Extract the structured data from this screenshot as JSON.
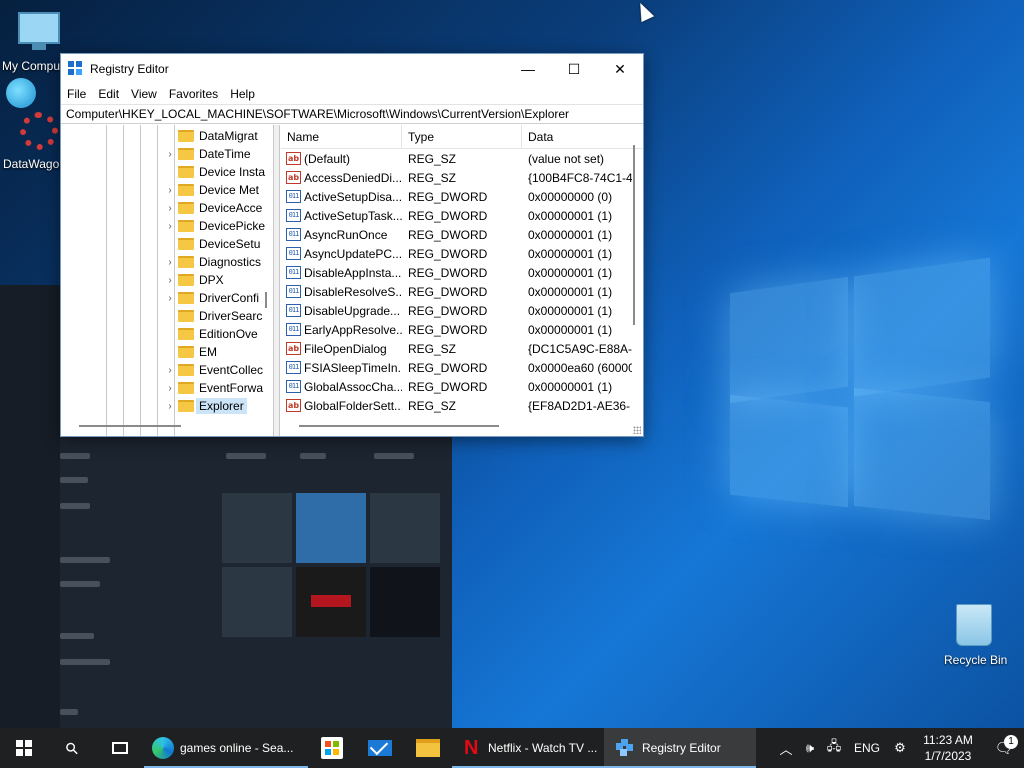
{
  "desktop": {
    "icons": {
      "my_computer": "My Computer",
      "datawagon": "DataWagon",
      "recycle_bin": "Recycle Bin"
    }
  },
  "window": {
    "title": "Registry Editor",
    "controls": {
      "minimize": "—",
      "maximize": "☐",
      "close": "✕"
    },
    "menu": [
      "File",
      "Edit",
      "View",
      "Favorites",
      "Help"
    ],
    "address": "Computer\\HKEY_LOCAL_MACHINE\\SOFTWARE\\Microsoft\\Windows\\CurrentVersion\\Explorer",
    "tree": [
      {
        "label": "DataMigrat",
        "expandable": false
      },
      {
        "label": "DateTime",
        "expandable": true
      },
      {
        "label": "Device Insta",
        "expandable": false
      },
      {
        "label": "Device Met",
        "expandable": true
      },
      {
        "label": "DeviceAcce",
        "expandable": true
      },
      {
        "label": "DevicePicke",
        "expandable": true
      },
      {
        "label": "DeviceSetu",
        "expandable": false
      },
      {
        "label": "Diagnostics",
        "expandable": true
      },
      {
        "label": "DPX",
        "expandable": true
      },
      {
        "label": "DriverConfi",
        "expandable": true
      },
      {
        "label": "DriverSearc",
        "expandable": false
      },
      {
        "label": "EditionOve",
        "expandable": false
      },
      {
        "label": "EM",
        "expandable": false
      },
      {
        "label": "EventCollec",
        "expandable": true
      },
      {
        "label": "EventForwa",
        "expandable": true
      },
      {
        "label": "Explorer",
        "expandable": true,
        "selected": true
      }
    ],
    "columns": {
      "name": "Name",
      "type": "Type",
      "data": "Data"
    },
    "values": [
      {
        "name": "(Default)",
        "type": "REG_SZ",
        "data": "(value not set)"
      },
      {
        "name": "AccessDeniedDi...",
        "type": "REG_SZ",
        "data": "{100B4FC8-74C1-4"
      },
      {
        "name": "ActiveSetupDisa...",
        "type": "REG_DWORD",
        "data": "0x00000000 (0)"
      },
      {
        "name": "ActiveSetupTask...",
        "type": "REG_DWORD",
        "data": "0x00000001 (1)"
      },
      {
        "name": "AsyncRunOnce",
        "type": "REG_DWORD",
        "data": "0x00000001 (1)"
      },
      {
        "name": "AsyncUpdatePC...",
        "type": "REG_DWORD",
        "data": "0x00000001 (1)"
      },
      {
        "name": "DisableAppInsta...",
        "type": "REG_DWORD",
        "data": "0x00000001 (1)"
      },
      {
        "name": "DisableResolveS...",
        "type": "REG_DWORD",
        "data": "0x00000001 (1)"
      },
      {
        "name": "DisableUpgrade...",
        "type": "REG_DWORD",
        "data": "0x00000001 (1)"
      },
      {
        "name": "EarlyAppResolve...",
        "type": "REG_DWORD",
        "data": "0x00000001 (1)"
      },
      {
        "name": "FileOpenDialog",
        "type": "REG_SZ",
        "data": "{DC1C5A9C-E88A-"
      },
      {
        "name": "FSIASleepTimeIn...",
        "type": "REG_DWORD",
        "data": "0x0000ea60 (60000"
      },
      {
        "name": "GlobalAssocCha...",
        "type": "REG_DWORD",
        "data": "0x00000001 (1)"
      },
      {
        "name": "GlobalFolderSett...",
        "type": "REG_SZ",
        "data": "{EF8AD2D1-AE36-"
      }
    ]
  },
  "taskbar": {
    "edge_label": "games online - Sea...",
    "netflix_label": "Netflix - Watch TV ...",
    "regedit_label": "Registry Editor",
    "search_glyph": "⚲",
    "tray": {
      "chevron": "︿",
      "volume": "🕪",
      "network": "🖧",
      "lang": "ENG",
      "settings": "⚙",
      "time": "11:23 AM",
      "date": "1/7/2023",
      "notif_glyph": "🗨",
      "notif_count": "1"
    }
  }
}
